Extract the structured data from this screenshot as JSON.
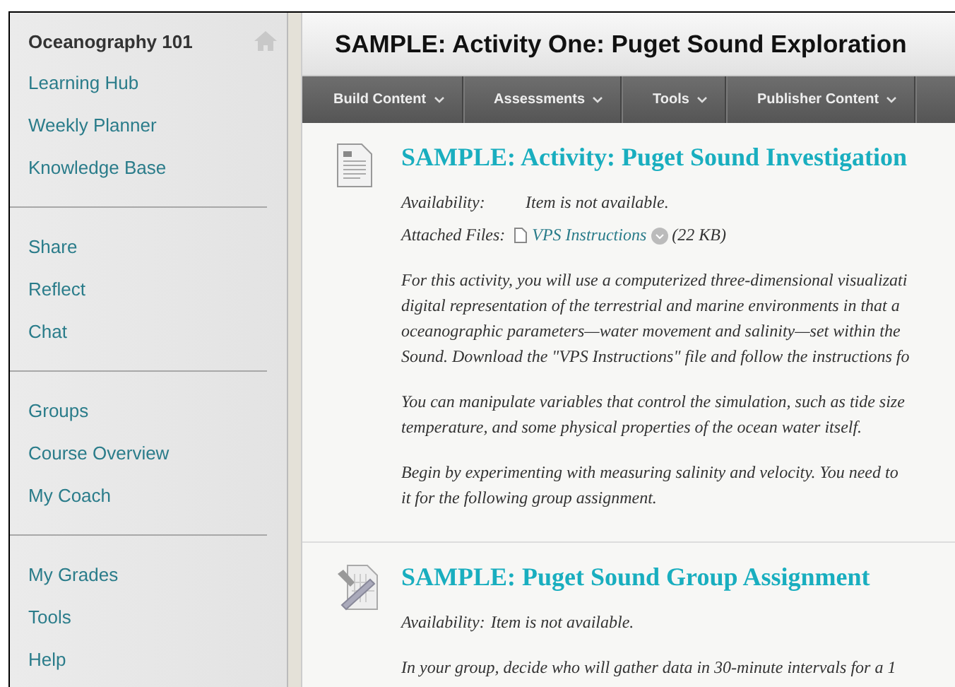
{
  "course": {
    "title": "Oceanography 101"
  },
  "menu_groups": [
    {
      "items": [
        {
          "label": "Learning Hub"
        },
        {
          "label": "Weekly Planner"
        },
        {
          "label": "Knowledge Base"
        }
      ]
    },
    {
      "items": [
        {
          "label": "Share"
        },
        {
          "label": "Reflect"
        },
        {
          "label": "Chat"
        }
      ]
    },
    {
      "items": [
        {
          "label": "Groups"
        },
        {
          "label": "Course Overview"
        },
        {
          "label": "My Coach"
        }
      ]
    },
    {
      "items": [
        {
          "label": "My Grades"
        },
        {
          "label": "Tools"
        },
        {
          "label": "Help"
        }
      ]
    }
  ],
  "page": {
    "title": "SAMPLE: Activity One: Puget Sound Exploration"
  },
  "toolbar": [
    {
      "label": "Build Content"
    },
    {
      "label": "Assessments"
    },
    {
      "label": "Tools"
    },
    {
      "label": "Publisher Content"
    }
  ],
  "items": [
    {
      "kind": "document",
      "title": "SAMPLE: Activity: Puget Sound Investigation",
      "availability_label": "Availability:",
      "availability": "Item is not available.",
      "files_label": "Attached Files:",
      "file_name": "VPS Instructions",
      "file_size": "(22 KB)",
      "paragraphs": [
        [
          "For this activity, you will use a computerized three-dimensional visualizati",
          "digital representation of the terrestrial and marine environments in that a",
          "oceanographic parameters—water movement and salinity—set within the",
          "Sound. Download the \"VPS Instructions\" file and follow the instructions fo"
        ],
        [
          "You can manipulate variables that control the simulation, such as tide size",
          "temperature, and some physical properties of the ocean water itself."
        ],
        [
          "Begin by experimenting with measuring salinity and velocity. You need to",
          "it for the following group assignment."
        ]
      ]
    },
    {
      "kind": "assignment",
      "title": "SAMPLE: Puget Sound Group Assignment",
      "availability_label": "Availability:",
      "availability": "Item is not available.",
      "paragraphs": [
        [
          "In your group, decide who will gather data in 30-minute intervals for a 1"
        ]
      ]
    }
  ]
}
